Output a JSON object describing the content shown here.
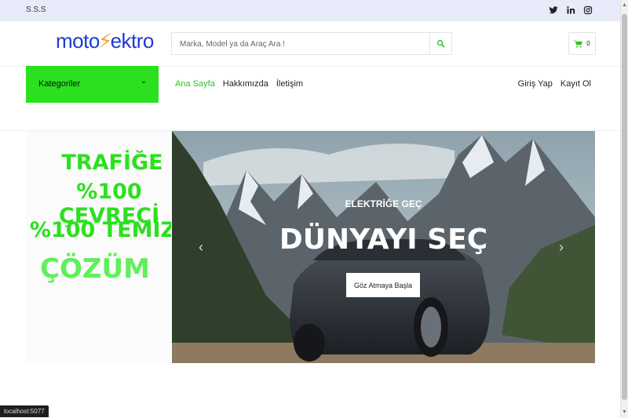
{
  "topbar": {
    "sss": "S.S.S",
    "social": [
      "twitter-icon",
      "linkedin-icon",
      "instagram-icon"
    ]
  },
  "header": {
    "logo": {
      "part1": "moto",
      "part2": "ektro"
    },
    "search_placeholder": "Marka, Model ya da Araç Ara !",
    "cart_count": "0"
  },
  "nav": {
    "categories_label": "Kategoriler",
    "links": [
      "Ana Sayfa",
      "Hakkımızda",
      "İletişim"
    ],
    "auth": [
      "Giriş Yap",
      "Kayıt Ol"
    ]
  },
  "promo": {
    "line1": "TRAFİĞE",
    "line2": "%100 ÇEVRECİ",
    "line3": "%100 TEMİZ",
    "line4": "ÇÖZÜM"
  },
  "hero": {
    "subtitle": "ELEKTRİĞE GEÇ",
    "title": "DÜNYAYI SEÇ",
    "cta": "Göz Atmaya Başla"
  },
  "status_url": "localhost:5077",
  "colors": {
    "accent": "#2be01e",
    "brand": "#1d3ad6",
    "topbar": "#e8ecfa"
  }
}
